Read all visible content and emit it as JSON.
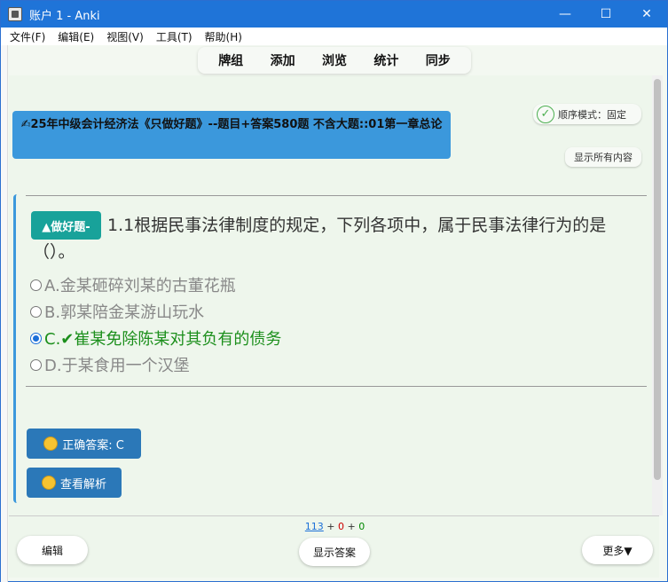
{
  "window": {
    "title": "账户 1 - Anki"
  },
  "titlebar_buttons": {
    "minimize": "—",
    "maximize": "☐",
    "close": "✕"
  },
  "menu": [
    "文件(F)",
    "编辑(E)",
    "视图(V)",
    "工具(T)",
    "帮助(H)"
  ],
  "toolbar": [
    "牌组",
    "添加",
    "浏览",
    "统计",
    "同步"
  ],
  "deck_banner": "✍25年中级会计经济法《只做好题》--题目+答案580题 不含大题::01第一章总论",
  "order_mode": {
    "icon": "check-circle-icon",
    "label": "顺序模式：固定"
  },
  "show_all_label": "显示所有内容",
  "card": {
    "tag": "▲做好题-",
    "question": "1.1根据民事法律制度的规定，下列各项中，属于民事法律行为的是（）。",
    "options": [
      {
        "text": "A.金某砸碎刘某的古董花瓶",
        "selected": false,
        "correct": false
      },
      {
        "text": "B.郭某陪金某游山玩水",
        "selected": false,
        "correct": false
      },
      {
        "text": "C.✔崔某免除陈某对其负有的债务",
        "selected": true,
        "correct": true
      },
      {
        "text": "D.于某食用一个汉堡",
        "selected": false,
        "correct": false
      }
    ],
    "answer_button": "正确答案: C",
    "explain_button": "查看解析"
  },
  "counts": {
    "new": "113",
    "sep1": " + ",
    "learn": "0",
    "sep2": " + ",
    "review": "0"
  },
  "bottom": {
    "edit": "编辑",
    "show_answer": "显示答案",
    "more": "更多▼"
  },
  "colors": {
    "accent": "#3b98dc",
    "tag": "#18a29a",
    "button": "#2b78b8",
    "correct": "#1c8f1c"
  }
}
